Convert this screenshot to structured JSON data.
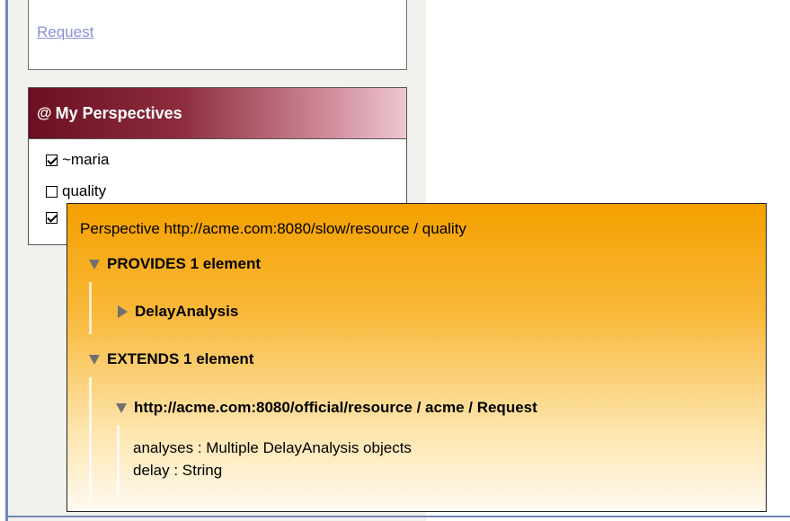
{
  "links": {
    "partial_label": "",
    "request_label": "Request"
  },
  "perspectives": {
    "title": "My Perspectives",
    "at_icon": "@",
    "items": [
      {
        "label": "~maria",
        "checked": true
      },
      {
        "label": "quality",
        "checked": false
      },
      {
        "label": "",
        "checked": true
      }
    ]
  },
  "tooltip": {
    "title": "Perspective http://acme.com:8080/slow/resource / quality",
    "provides": {
      "label": "PROVIDES 1 element",
      "items": [
        {
          "label": "DelayAnalysis",
          "expanded": false
        }
      ]
    },
    "extends": {
      "label": "EXTENDS 1 element",
      "items": [
        {
          "label": "http://acme.com:8080/official/resource / acme / Request",
          "expanded": true,
          "attributes": [
            "analyses : Multiple DelayAnalysis objects",
            "delay : String"
          ]
        }
      ]
    }
  },
  "colors": {
    "header_gradient_start": "#6b1020",
    "header_gradient_end": "#efc6d0",
    "tooltip_orange": "#f4a000",
    "link": "#8a8fd8"
  }
}
